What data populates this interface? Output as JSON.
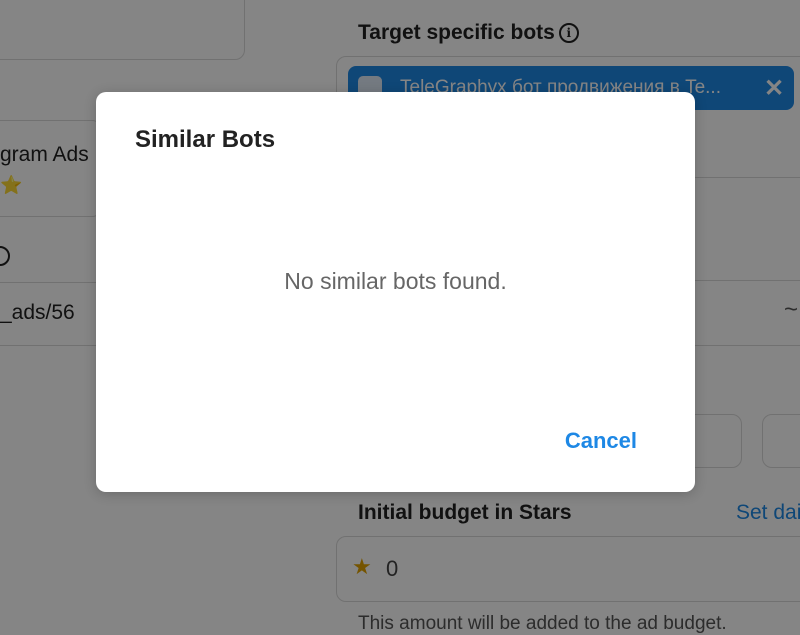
{
  "background": {
    "left": {
      "card_text": "gram Ads",
      "card_stars": "⭐",
      "input_value": "_ads/56"
    },
    "target": {
      "title": "Target specific bots",
      "chip_label": "TeleGraphyx бот продвижения в Te...",
      "chip_close": "✕"
    },
    "budget": {
      "title": "Initial budget in Stars",
      "set_link": "Set dai",
      "value": "0",
      "note": "This amount will be added to the ad budget."
    },
    "chevron": "~"
  },
  "dialog": {
    "title": "Similar Bots",
    "message": "No similar bots found.",
    "cancel_label": "Cancel"
  },
  "colors": {
    "accent": "#1e88e5",
    "overlay": "rgba(0,0,0,0.48)"
  }
}
